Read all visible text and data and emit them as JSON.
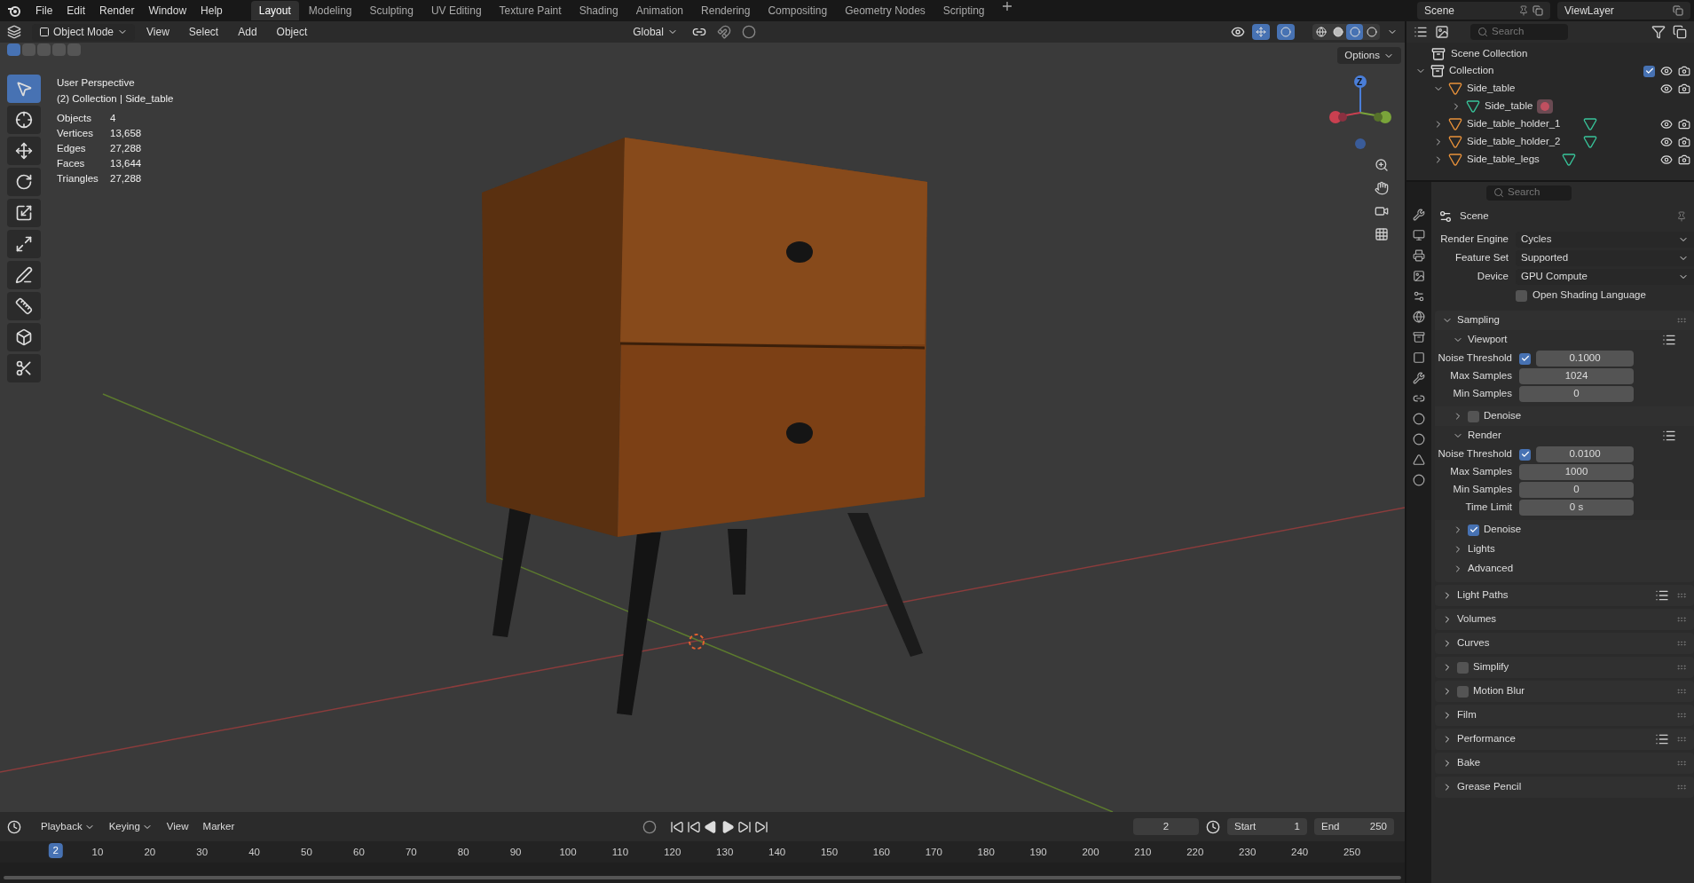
{
  "menu": [
    "File",
    "Edit",
    "Render",
    "Window",
    "Help"
  ],
  "workspaces": [
    {
      "label": "Layout",
      "selected": true
    },
    {
      "label": "Modeling",
      "selected": false
    },
    {
      "label": "Sculpting",
      "selected": false
    },
    {
      "label": "UV Editing",
      "selected": false
    },
    {
      "label": "Texture Paint",
      "selected": false
    },
    {
      "label": "Shading",
      "selected": false
    },
    {
      "label": "Animation",
      "selected": false
    },
    {
      "label": "Rendering",
      "selected": false
    },
    {
      "label": "Compositing",
      "selected": false
    },
    {
      "label": "Geometry Nodes",
      "selected": false
    },
    {
      "label": "Scripting",
      "selected": false
    }
  ],
  "scene": "Scene",
  "view_layer": "ViewLayer",
  "viewport": {
    "mode": "Object Mode",
    "menus": [
      "View",
      "Select",
      "Add",
      "Object"
    ],
    "orientation": "Global",
    "options": "Options",
    "title": "User Perspective",
    "context": "(2) Collection | Side_table",
    "select_modes": [
      {
        "selected": true
      },
      {
        "selected": false
      },
      {
        "selected": false
      },
      {
        "selected": false
      },
      {
        "selected": false
      }
    ],
    "stats": [
      {
        "label": "Objects",
        "value": "4"
      },
      {
        "label": "Vertices",
        "value": "13,658"
      },
      {
        "label": "Edges",
        "value": "27,288"
      },
      {
        "label": "Faces",
        "value": "13,644"
      },
      {
        "label": "Triangles",
        "value": "27,288"
      }
    ],
    "tools": [
      {
        "kind": "select",
        "selected": true
      },
      {
        "kind": "cursor",
        "selected": false
      },
      {
        "kind": "move",
        "selected": false
      },
      {
        "kind": "rotate",
        "selected": false
      },
      {
        "kind": "scale",
        "selected": false
      },
      {
        "kind": "transform",
        "selected": false
      },
      {
        "kind": "annotate",
        "selected": false
      },
      {
        "kind": "measure",
        "selected": false
      },
      {
        "kind": "add_cube",
        "selected": false
      },
      {
        "kind": "cut",
        "selected": false
      }
    ],
    "gizmos_on": true,
    "overlays_on": true,
    "shading": [
      {
        "kind": "wireframe",
        "selected": false
      },
      {
        "kind": "solid",
        "selected": false
      },
      {
        "kind": "material",
        "selected": true
      },
      {
        "kind": "rendered",
        "selected": false
      }
    ],
    "axes": [
      "Z"
    ]
  },
  "outliner": {
    "search": "Search",
    "root": "Scene Collection",
    "tree": [
      {
        "kind": "collection",
        "label": "Collection",
        "expanded": true,
        "checked": true,
        "children": [
          {
            "kind": "object",
            "label": "Side_table",
            "expanded": true,
            "children": [
              {
                "kind": "mesh",
                "label": "Side_table",
                "expanded": false,
                "has_material": true
              }
            ]
          },
          {
            "kind": "object",
            "label": "Side_table_holder_1",
            "expanded": false
          },
          {
            "kind": "object",
            "label": "Side_table_holder_2",
            "expanded": false
          },
          {
            "kind": "object",
            "label": "Side_table_legs",
            "expanded": false
          }
        ]
      }
    ]
  },
  "properties": {
    "search": "Search",
    "context": "Scene",
    "fields": [
      {
        "label": "Render Engine",
        "value": "Cycles"
      },
      {
        "label": "Feature Set",
        "value": "Supported"
      },
      {
        "label": "Device",
        "value": "GPU Compute"
      }
    ],
    "osl": {
      "label": "Open Shading Language",
      "checked": false
    },
    "sampling": {
      "label": "Sampling",
      "expanded": true,
      "children": [
        {
          "kind": "subpanel",
          "label": "Viewport",
          "expanded": true,
          "presets": true,
          "rows": [
            {
              "kind": "check_number",
              "label": "Noise Threshold",
              "checked": true,
              "value": "0.1000"
            },
            {
              "kind": "number",
              "label": "Max Samples",
              "value": "1024"
            },
            {
              "kind": "number",
              "label": "Min Samples",
              "value": "0"
            }
          ]
        },
        {
          "kind": "check_subpanel",
          "label": "Denoise",
          "expanded": false,
          "checked": false
        },
        {
          "kind": "subpanel",
          "label": "Render",
          "expanded": true,
          "presets": true,
          "rows": [
            {
              "kind": "check_number",
              "label": "Noise Threshold",
              "checked": true,
              "value": "0.0100"
            },
            {
              "kind": "number",
              "label": "Max Samples",
              "value": "1000"
            },
            {
              "kind": "number",
              "label": "Min Samples",
              "value": "0"
            },
            {
              "kind": "number",
              "label": "Time Limit",
              "value": "0 s"
            }
          ]
        },
        {
          "kind": "check_subpanel",
          "label": "Denoise",
          "expanded": false,
          "checked": true
        },
        {
          "kind": "subpanel",
          "label": "Lights",
          "expanded": false,
          "presets": false
        },
        {
          "kind": "subpanel",
          "label": "Advanced",
          "expanded": false,
          "presets": false
        }
      ]
    },
    "panels": [
      {
        "label": "Light Paths",
        "kind": "plain",
        "presets": true
      },
      {
        "label": "Volumes",
        "kind": "plain",
        "presets": false
      },
      {
        "label": "Curves",
        "kind": "plain",
        "presets": false
      },
      {
        "label": "Simplify",
        "kind": "check",
        "checked": false,
        "presets": false
      },
      {
        "label": "Motion Blur",
        "kind": "check",
        "checked": false,
        "presets": false
      },
      {
        "label": "Film",
        "kind": "plain",
        "presets": false
      },
      {
        "label": "Performance",
        "kind": "plain",
        "presets": true
      },
      {
        "label": "Bake",
        "kind": "plain",
        "presets": false
      },
      {
        "label": "Grease Pencil",
        "kind": "plain",
        "presets": false
      }
    ]
  },
  "timeline": {
    "menus": [
      "Playback",
      "Keying",
      "View",
      "Marker"
    ],
    "current": "2",
    "start_label": "Start",
    "start": "1",
    "end_label": "End",
    "end": "250",
    "marker": "2",
    "ticks": [
      "10",
      "20",
      "30",
      "40",
      "50",
      "60",
      "70",
      "80",
      "90",
      "100",
      "110",
      "120",
      "130",
      "140",
      "150",
      "160",
      "170",
      "180",
      "190",
      "200",
      "210",
      "220",
      "230",
      "240",
      "250"
    ]
  }
}
